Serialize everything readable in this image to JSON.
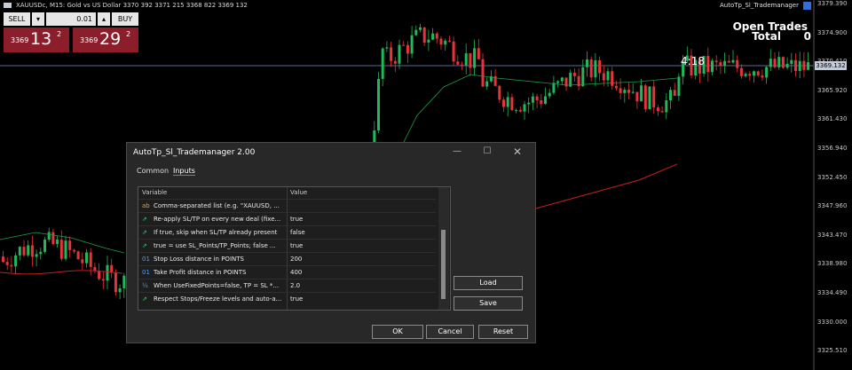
{
  "symbol_info": "XAUUSDc, M15:  Gold vs US Dollar  3370 392 3371 215 3368 822 3369 132",
  "ea_name": "AutoTp_Sl_Trademanager",
  "trade_panel": {
    "sell_label": "SELL",
    "buy_label": "BUY",
    "volume": "0.01",
    "sell_small": "3369",
    "sell_big": "13",
    "sell_sup": "2",
    "buy_small": "3369",
    "buy_big": "29",
    "buy_sup": "2"
  },
  "overlay": {
    "open_trades": "Open Trades",
    "total_label": "Total",
    "total_value": "0",
    "timer": "4:18"
  },
  "axis": {
    "current_price": "3369.132",
    "labels": [
      "3379.390",
      "3374.900",
      "3370.410",
      "3365.920",
      "3361.430",
      "3356.940",
      "3352.450",
      "3347.960",
      "3343.470",
      "3338.980",
      "3334.490",
      "3330.000",
      "3325.510"
    ]
  },
  "dialog": {
    "title": "AutoTp_Sl_Trademanager 2.00",
    "tabs": [
      "Common",
      "Inputs"
    ],
    "col_variable": "Variable",
    "col_value": "Value",
    "rows": [
      {
        "icon": "ab",
        "var": "Comma-separated list (e.g. \"XAUUSD, ...",
        "val": ""
      },
      {
        "icon": "⇗",
        "var": "Re-apply SL/TP on every new deal (fixe...",
        "val": "true"
      },
      {
        "icon": "⇗",
        "var": "If true, skip when SL/TP already present",
        "val": "false"
      },
      {
        "icon": "⇗",
        "var": "true = use SL_Points/TP_Points; false ...",
        "val": "true"
      },
      {
        "icon": "01",
        "var": "Stop Loss distance in POINTS",
        "val": "200"
      },
      {
        "icon": "01",
        "var": "Take Profit distance in POINTS",
        "val": "400"
      },
      {
        "icon": "½",
        "var": "When UseFixedPoints=false, TP = SL *...",
        "val": "2.0"
      },
      {
        "icon": "⇗",
        "var": "Respect Stops/Freeze levels and auto-a...",
        "val": "true"
      }
    ],
    "load_label": "Load",
    "save_label": "Save",
    "ok_label": "OK",
    "cancel_label": "Cancel",
    "reset_label": "Reset"
  },
  "colors": {
    "bull": "#1fb85a",
    "bear": "#e8333b",
    "ma_red": "#c42020",
    "ma_green": "#1fa048",
    "price_bg": "#8b1e2a"
  }
}
